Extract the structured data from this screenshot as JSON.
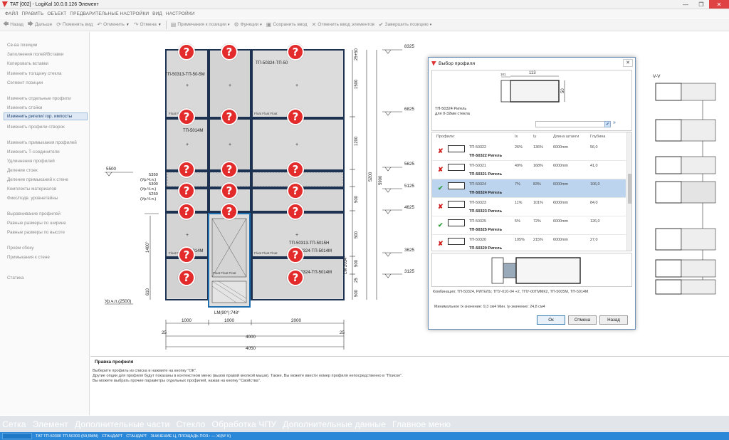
{
  "window": {
    "title": "TAT [002] - LogiKal 10.0.0.126 Элемент",
    "minimize": "—",
    "maximize": "❐",
    "close": "✕"
  },
  "menu": [
    "ФАЙЛ",
    "ПРАВИТЬ",
    "ОБЪЕКТ",
    "ПРЕДВАРИТЕЛЬНЫЕ НАСТРОЙКИ",
    "ВИД",
    "НАСТРОЙКИ"
  ],
  "toolbar": {
    "back": "Назад",
    "next": "Дальше",
    "change_view": "Поменять вид",
    "undo": "Отменить",
    "redo": "Отмена",
    "position_notes": "Примечания к позиции",
    "functions": "Функции",
    "save_input": "Сохранить ввод",
    "cancel_input": "Отменить ввод элементов",
    "finish_position": "Завершить позицию"
  },
  "left_panel": [
    "Св-ва позиции",
    "Заполнения полей/Вставки",
    "Копировать вставки",
    "Изменить толщину стекла",
    "Сегмент позиции",
    "Изменить отдельные профили",
    "Изменить стойки",
    "Изменить ригели/ гор. импосты",
    "Изменить профили створок",
    "Изменить примыкания профилей",
    "Изменить Т-соединители",
    "Удлиннения профилей",
    "Деление стоек",
    "Деление примыканий к стене",
    "Комплекты материалов",
    "Фикс/подв. уровнетвйны",
    "Выравнивание профилей",
    "Равные размеры по ширине",
    "Равные размеры по высоте",
    "Проём сбоку",
    "Примыкания к стене",
    "Статика"
  ],
  "drawing": {
    "level_labels": [
      "8325",
      "6825",
      "5625",
      "5125",
      "4625",
      "3625",
      "3125"
    ],
    "left_levels": [
      "5500",
      "5350",
      "(Ур.Ч.п.)",
      "5300",
      "(Ур.Ч.п.)",
      "5250",
      "(Ур.Ч.п.)"
    ],
    "vertical_dims": [
      "25+50",
      "1500",
      "1200",
      "500",
      "500",
      "500",
      "25",
      "500",
      "5200",
      "5900",
      "LM 2034°",
      "1400°",
      "610"
    ],
    "floor_label": "Ур.ч.п.(2500)",
    "horizontal_dims": [
      "1000",
      "1000",
      "2000",
      "25",
      "4000",
      "25",
      "4050"
    ],
    "door_label": "LM(90°):748°",
    "profile_labels": [
      "ТП-50313-ТП-50-5М",
      "ТП-50324-ТП-50",
      "ТП-50313-ТП-5015М",
      "ТП-50313-ТП-5015Н",
      "ТП-50324-ТП-5014М",
      "ТП-50324-ТП-5014М",
      "ТП-5014М"
    ],
    "glass_note": "Float Float Float",
    "section_label": "V-V",
    "pin_glyph": "?"
  },
  "dialog": {
    "title": "Выбор профиля",
    "preview_width": "113",
    "preview_height": "50",
    "preview_small": "101",
    "preview_name": "ТП-50324 Ригель",
    "preview_desc": "для 0-32мм стекла",
    "filter_button": "✔",
    "columns": [
      "Профили:",
      "Ix",
      "Iy",
      "Длина штанги",
      "Глубина"
    ],
    "rows": [
      {
        "mark": "✘",
        "code": "ТП-50322",
        "ix": "26%",
        "iy": "136%",
        "length": "6000mm",
        "depth": "56,0",
        "name": "ТП-50322 Ригель"
      },
      {
        "mark": "✘",
        "code": "ТП-50321",
        "ix": "49%",
        "iy": "168%",
        "length": "6000mm",
        "depth": "41,0",
        "name": "ТП-50321 Ригель"
      },
      {
        "mark": "✔",
        "code": "ТП-50324",
        "ix": "7%",
        "iy": "83%",
        "length": "6000mm",
        "depth": "106,0",
        "name": "ТП-50324 Ригель"
      },
      {
        "mark": "✘",
        "code": "ТП-50323",
        "ix": "11%",
        "iy": "101%",
        "length": "6000mm",
        "depth": "84,0",
        "name": "ТП-50323 Ригель"
      },
      {
        "mark": "✔",
        "code": "ТП-50325",
        "ix": "5%",
        "iy": "72%",
        "length": "6000mm",
        "depth": "126,0",
        "name": "ТП-50325 Ригель"
      },
      {
        "mark": "✘",
        "code": "ТП-50320",
        "ix": "105%",
        "iy": "215%",
        "length": "6000mm",
        "depth": "27,0",
        "name": "ТП-50320 Ригель"
      }
    ],
    "combination": "Комбинация: ТП-50324, РИГЕЛЬ; ТПУ-010-04 +2, ТПУ-00ТММК2, ТП-5005М, ТП-5014М",
    "min_values": "Минимальное Ix-значение: 9,3 см4   Мин. Iy-значение: 24,8 см4",
    "ok": "Ок",
    "cancel": "Отмена",
    "back": "Назад"
  },
  "info": {
    "heading": "Правка профиля",
    "lines": [
      "Выберите профиль из списка и нажмите на кнопку \"ОК\".",
      "Другие опции для профиля будут показаны в контекстном меню (вызов правой кнопкой мыши). Также, Вы можете ввести номер профиля непосредственно в \"Поиске\".",
      "Вы можете выбрать прочие параметры отдельных профилей, нажав на кнопку \"Свойства\"."
    ]
  },
  "bottom_tabs": [
    "Сетка",
    "Элемент",
    "Дополнительные части",
    "Стекло",
    "Обработка ЧПУ",
    "Дополнительные данные",
    "Главное меню"
  ],
  "status": [
    "TAT ТП-50300 ТП-50300 (59,5MM)",
    "СТАНДАРТ",
    "СТАНДАРТ",
    "ЗНАЧЕНИЕ Ц, ПЛОЩАДЬ ПОЗ.: — Ж(М² К)"
  ]
}
